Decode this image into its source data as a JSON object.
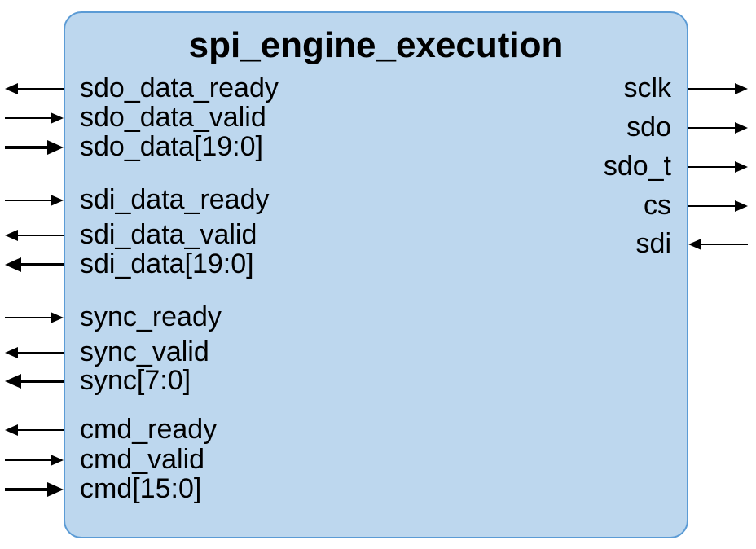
{
  "block": {
    "title": "spi_engine_execution"
  },
  "left_ports": [
    {
      "name": "sdo_data_ready",
      "direction": "out",
      "bus": false
    },
    {
      "name": "sdo_data_valid",
      "direction": "in",
      "bus": false
    },
    {
      "name": "sdo_data[19:0]",
      "direction": "in",
      "bus": true
    },
    {
      "name": "sdi_data_ready",
      "direction": "in",
      "bus": false
    },
    {
      "name": "sdi_data_valid",
      "direction": "out",
      "bus": false
    },
    {
      "name": "sdi_data[19:0]",
      "direction": "out",
      "bus": true
    },
    {
      "name": "sync_ready",
      "direction": "in",
      "bus": false
    },
    {
      "name": "sync_valid",
      "direction": "out",
      "bus": false
    },
    {
      "name": "sync[7:0]",
      "direction": "out",
      "bus": true
    },
    {
      "name": "cmd_ready",
      "direction": "out",
      "bus": false
    },
    {
      "name": "cmd_valid",
      "direction": "in",
      "bus": false
    },
    {
      "name": "cmd[15:0]",
      "direction": "in",
      "bus": true
    }
  ],
  "right_ports": [
    {
      "name": "sclk",
      "direction": "out",
      "bus": false
    },
    {
      "name": "sdo",
      "direction": "out",
      "bus": false
    },
    {
      "name": "sdo_t",
      "direction": "out",
      "bus": false
    },
    {
      "name": "cs",
      "direction": "out",
      "bus": false
    },
    {
      "name": "sdi",
      "direction": "in",
      "bus": false
    }
  ],
  "colors": {
    "block_fill": "#bdd7ee",
    "block_border": "#5b9bd5",
    "text": "#000000",
    "arrow": "#000000"
  }
}
